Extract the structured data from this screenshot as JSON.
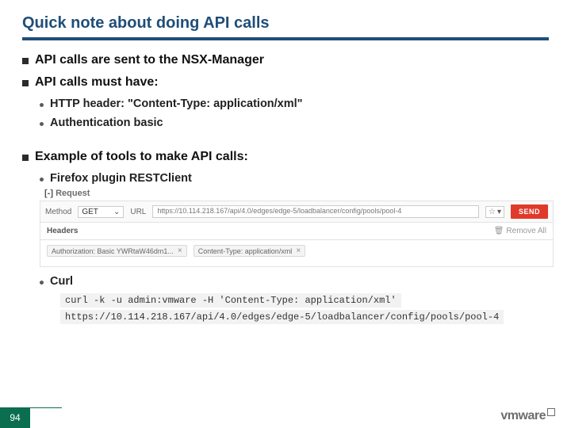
{
  "title": "Quick note about doing API calls",
  "bullets": {
    "b1": "API calls are sent to the NSX-Manager",
    "b2": "API calls must have:",
    "b2_sub1": "HTTP header: \"Content-Type: application/xml\"",
    "b2_sub2": "Authentication basic",
    "b3": "Example of tools to make API calls:",
    "b3_sub1": "Firefox plugin RESTClient",
    "b3_sub2": "Curl"
  },
  "restclient": {
    "toggle": "[-]",
    "request_label": "Request",
    "method_label": "Method",
    "method_value": "GET",
    "url_label": "URL",
    "url_value": "https://10.114.218.167/api/4.0/edges/edge-5/loadbalancer/config/pools/pool-4",
    "send_label": "SEND",
    "headers_label": "Headers",
    "remove_all_label": "Remove All",
    "tag_auth": "Authorization: Basic YWRtaW46dm1...",
    "tag_ct": "Content-Type: application/xml"
  },
  "curl": {
    "line1": "curl -k -u admin:vmware -H 'Content-Type: application/xml'",
    "line2": "https://10.114.218.167/api/4.0/edges/edge-5/loadbalancer/config/pools/pool-4"
  },
  "footer": {
    "page": "94",
    "logo": "vmware"
  }
}
